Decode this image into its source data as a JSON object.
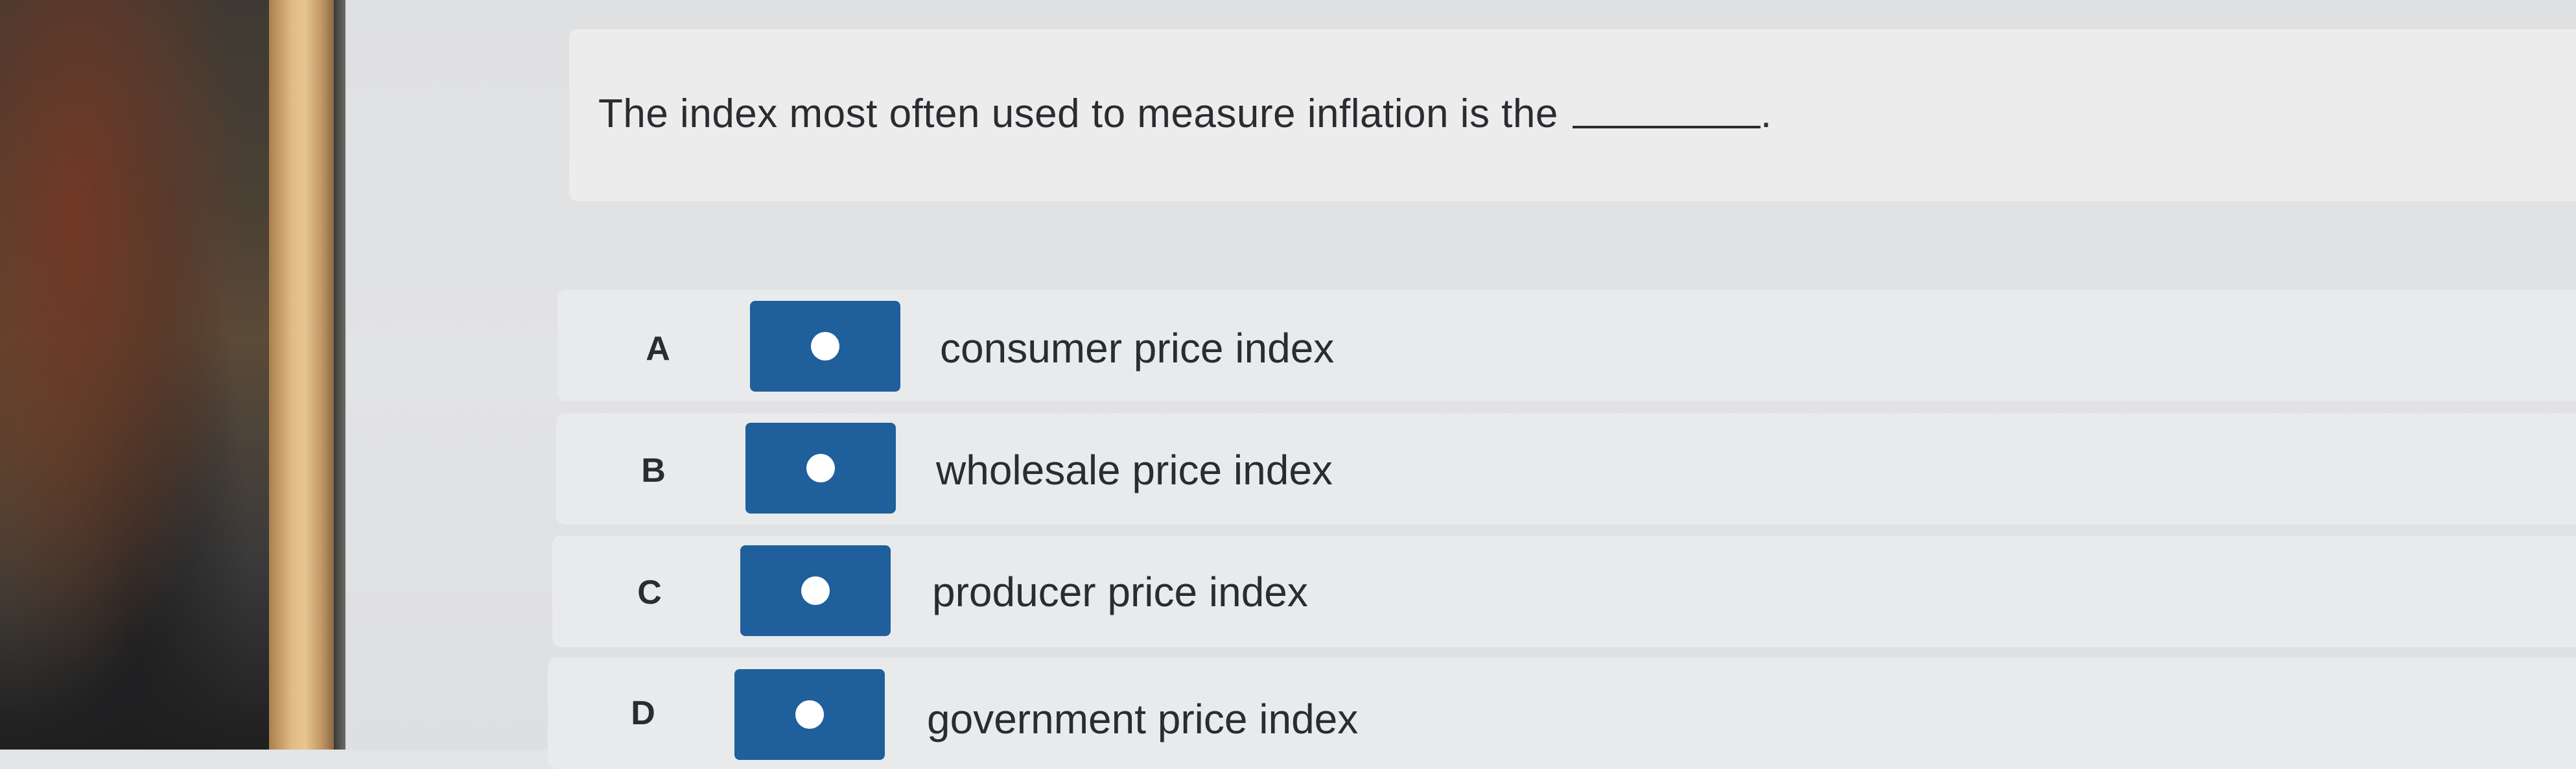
{
  "question": {
    "text": "The index most often used to measure inflation is the",
    "trailing": "."
  },
  "choices": [
    {
      "letter": "A",
      "label": "consumer price index"
    },
    {
      "letter": "B",
      "label": "wholesale price index"
    },
    {
      "letter": "C",
      "label": "producer price index"
    },
    {
      "letter": "D",
      "label": "government price index"
    }
  ],
  "colors": {
    "radio_button": "#1f5f9c",
    "text": "#2a2c30"
  }
}
